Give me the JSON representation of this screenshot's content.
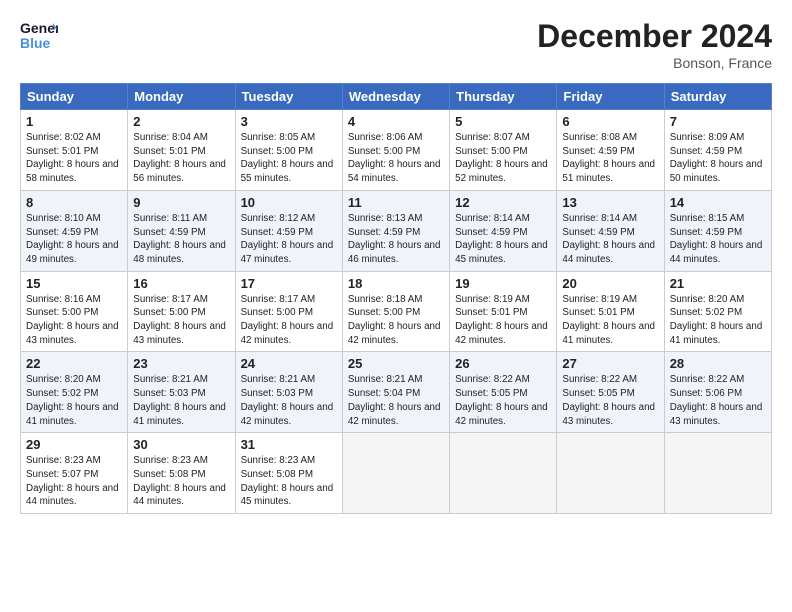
{
  "header": {
    "logo_line1": "General",
    "logo_line2": "Blue",
    "month": "December 2024",
    "location": "Bonson, France"
  },
  "days_of_week": [
    "Sunday",
    "Monday",
    "Tuesday",
    "Wednesday",
    "Thursday",
    "Friday",
    "Saturday"
  ],
  "weeks": [
    [
      {
        "day": "1",
        "sunrise": "8:02 AM",
        "sunset": "5:01 PM",
        "daylight": "8 hours and 58 minutes."
      },
      {
        "day": "2",
        "sunrise": "8:04 AM",
        "sunset": "5:01 PM",
        "daylight": "8 hours and 56 minutes."
      },
      {
        "day": "3",
        "sunrise": "8:05 AM",
        "sunset": "5:00 PM",
        "daylight": "8 hours and 55 minutes."
      },
      {
        "day": "4",
        "sunrise": "8:06 AM",
        "sunset": "5:00 PM",
        "daylight": "8 hours and 54 minutes."
      },
      {
        "day": "5",
        "sunrise": "8:07 AM",
        "sunset": "5:00 PM",
        "daylight": "8 hours and 52 minutes."
      },
      {
        "day": "6",
        "sunrise": "8:08 AM",
        "sunset": "4:59 PM",
        "daylight": "8 hours and 51 minutes."
      },
      {
        "day": "7",
        "sunrise": "8:09 AM",
        "sunset": "4:59 PM",
        "daylight": "8 hours and 50 minutes."
      }
    ],
    [
      {
        "day": "8",
        "sunrise": "8:10 AM",
        "sunset": "4:59 PM",
        "daylight": "8 hours and 49 minutes."
      },
      {
        "day": "9",
        "sunrise": "8:11 AM",
        "sunset": "4:59 PM",
        "daylight": "8 hours and 48 minutes."
      },
      {
        "day": "10",
        "sunrise": "8:12 AM",
        "sunset": "4:59 PM",
        "daylight": "8 hours and 47 minutes."
      },
      {
        "day": "11",
        "sunrise": "8:13 AM",
        "sunset": "4:59 PM",
        "daylight": "8 hours and 46 minutes."
      },
      {
        "day": "12",
        "sunrise": "8:14 AM",
        "sunset": "4:59 PM",
        "daylight": "8 hours and 45 minutes."
      },
      {
        "day": "13",
        "sunrise": "8:14 AM",
        "sunset": "4:59 PM",
        "daylight": "8 hours and 44 minutes."
      },
      {
        "day": "14",
        "sunrise": "8:15 AM",
        "sunset": "4:59 PM",
        "daylight": "8 hours and 44 minutes."
      }
    ],
    [
      {
        "day": "15",
        "sunrise": "8:16 AM",
        "sunset": "5:00 PM",
        "daylight": "8 hours and 43 minutes."
      },
      {
        "day": "16",
        "sunrise": "8:17 AM",
        "sunset": "5:00 PM",
        "daylight": "8 hours and 43 minutes."
      },
      {
        "day": "17",
        "sunrise": "8:17 AM",
        "sunset": "5:00 PM",
        "daylight": "8 hours and 42 minutes."
      },
      {
        "day": "18",
        "sunrise": "8:18 AM",
        "sunset": "5:00 PM",
        "daylight": "8 hours and 42 minutes."
      },
      {
        "day": "19",
        "sunrise": "8:19 AM",
        "sunset": "5:01 PM",
        "daylight": "8 hours and 42 minutes."
      },
      {
        "day": "20",
        "sunrise": "8:19 AM",
        "sunset": "5:01 PM",
        "daylight": "8 hours and 41 minutes."
      },
      {
        "day": "21",
        "sunrise": "8:20 AM",
        "sunset": "5:02 PM",
        "daylight": "8 hours and 41 minutes."
      }
    ],
    [
      {
        "day": "22",
        "sunrise": "8:20 AM",
        "sunset": "5:02 PM",
        "daylight": "8 hours and 41 minutes."
      },
      {
        "day": "23",
        "sunrise": "8:21 AM",
        "sunset": "5:03 PM",
        "daylight": "8 hours and 41 minutes."
      },
      {
        "day": "24",
        "sunrise": "8:21 AM",
        "sunset": "5:03 PM",
        "daylight": "8 hours and 42 minutes."
      },
      {
        "day": "25",
        "sunrise": "8:21 AM",
        "sunset": "5:04 PM",
        "daylight": "8 hours and 42 minutes."
      },
      {
        "day": "26",
        "sunrise": "8:22 AM",
        "sunset": "5:05 PM",
        "daylight": "8 hours and 42 minutes."
      },
      {
        "day": "27",
        "sunrise": "8:22 AM",
        "sunset": "5:05 PM",
        "daylight": "8 hours and 43 minutes."
      },
      {
        "day": "28",
        "sunrise": "8:22 AM",
        "sunset": "5:06 PM",
        "daylight": "8 hours and 43 minutes."
      }
    ],
    [
      {
        "day": "29",
        "sunrise": "8:23 AM",
        "sunset": "5:07 PM",
        "daylight": "8 hours and 44 minutes."
      },
      {
        "day": "30",
        "sunrise": "8:23 AM",
        "sunset": "5:08 PM",
        "daylight": "8 hours and 44 minutes."
      },
      {
        "day": "31",
        "sunrise": "8:23 AM",
        "sunset": "5:08 PM",
        "daylight": "8 hours and 45 minutes."
      },
      null,
      null,
      null,
      null
    ]
  ],
  "labels": {
    "sunrise": "Sunrise:",
    "sunset": "Sunset:",
    "daylight": "Daylight:"
  }
}
